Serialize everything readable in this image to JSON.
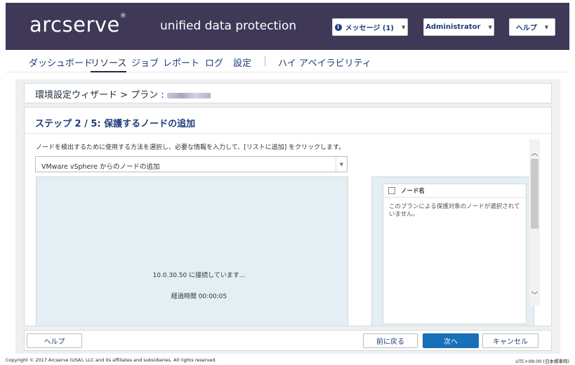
{
  "header": {
    "logo": "arcserve",
    "logo_mark": "®",
    "product": "unified data protection",
    "messages_label": "メッセージ (1)",
    "user_label": "Administrator",
    "help_label": "ヘルプ"
  },
  "nav": {
    "items": [
      "ダッシュボード",
      "リソース",
      "ジョブ",
      "レポート",
      "ログ",
      "設定",
      "ハイ アベイラビリティ"
    ],
    "active": "リソース"
  },
  "breadcrumb": {
    "text": "環境設定ウィザード > プラン :"
  },
  "step": {
    "title": "ステップ 2 / 5: 保護するノードの追加",
    "description": "ノードを検出するために使用する方法を選択し、必要な情報を入力して、[リストに追加] をクリックします。",
    "method_selected": "VMware vSphere からのノードの追加"
  },
  "status": {
    "connecting": "10.0.30.50 に接続しています...",
    "elapsed": "経過時間  00:00:05"
  },
  "node_list": {
    "header": "ノード名",
    "empty_message": "このプランによる保護対象のノードが選択されていません。"
  },
  "footer": {
    "help": "ヘルプ",
    "back": "前に戻る",
    "next": "次へ",
    "cancel": "キャンセル"
  },
  "copyright": "Copyright © 2017 Arcserve (USA), LLC and its affiliates and subsidiaries. All rights reserved.",
  "timezone": "UTC+09:00 (日本標準時)",
  "colors": {
    "header_bg": "#3f3857",
    "nav_link": "#1c3d7a",
    "primary_button": "#1a6fb9",
    "pane_bg": "#e3eff3"
  }
}
